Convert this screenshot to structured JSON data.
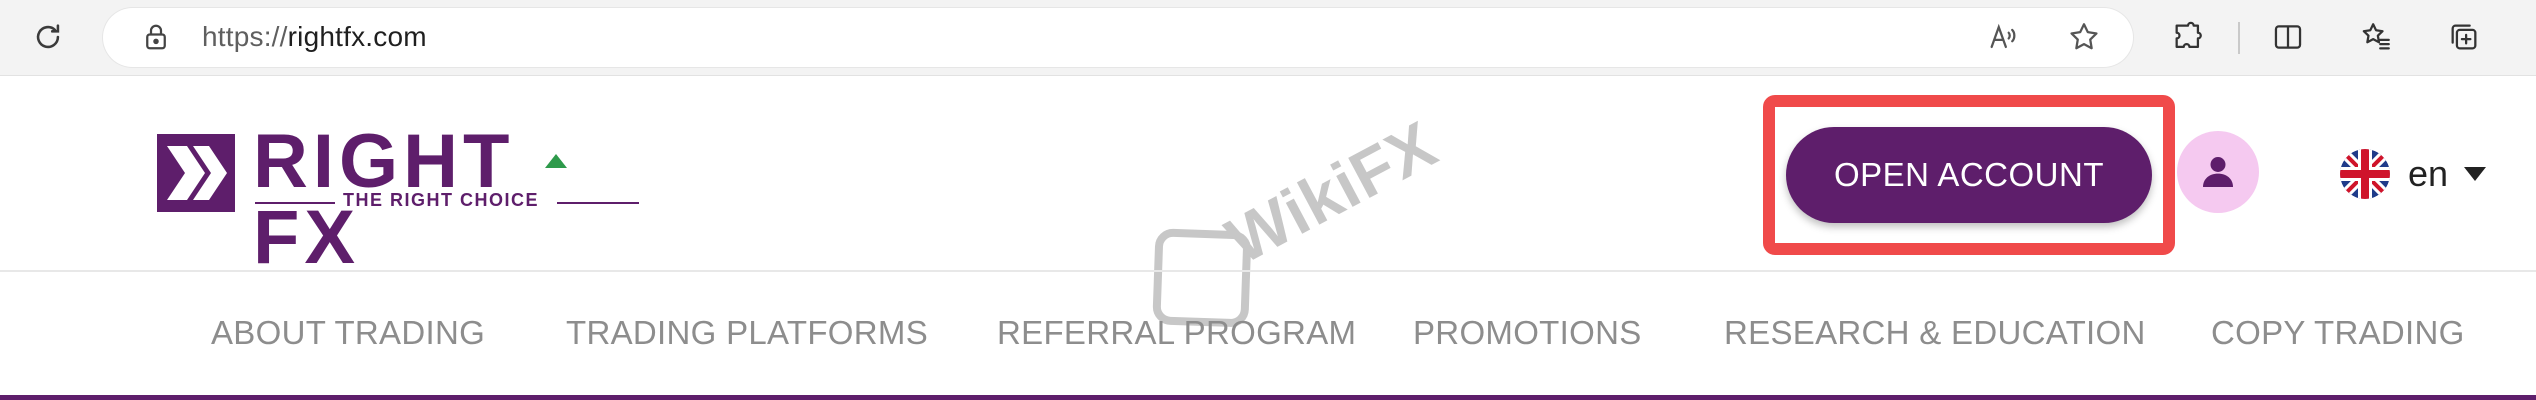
{
  "browser": {
    "url_protocol": "https://",
    "url_host": "rightfx.com",
    "icons": [
      "reload-icon",
      "lock-icon",
      "read-aloud-icon",
      "star-icon",
      "extensions-icon",
      "split-screen-icon",
      "favorites-icon",
      "collections-icon"
    ]
  },
  "logo": {
    "word": "RIGHT FX",
    "tagline": "THE RIGHT CHOICE",
    "brand_color": "#5e1e6b",
    "arrow_color": "#2e9a4b"
  },
  "watermark": {
    "text": "WikiFX"
  },
  "header": {
    "open_account_label": "OPEN ACCOUNT",
    "highlight_color": "#f04a4a",
    "user_icon": "user-icon",
    "language_label": "en"
  },
  "nav": {
    "items": [
      {
        "label": "ABOUT TRADING"
      },
      {
        "label": "TRADING PLATFORMS"
      },
      {
        "label": "REFERRAL PROGRAM"
      },
      {
        "label": "PROMOTIONS"
      },
      {
        "label": "RESEARCH & EDUCATION"
      },
      {
        "label": "COPY TRADING"
      }
    ]
  }
}
